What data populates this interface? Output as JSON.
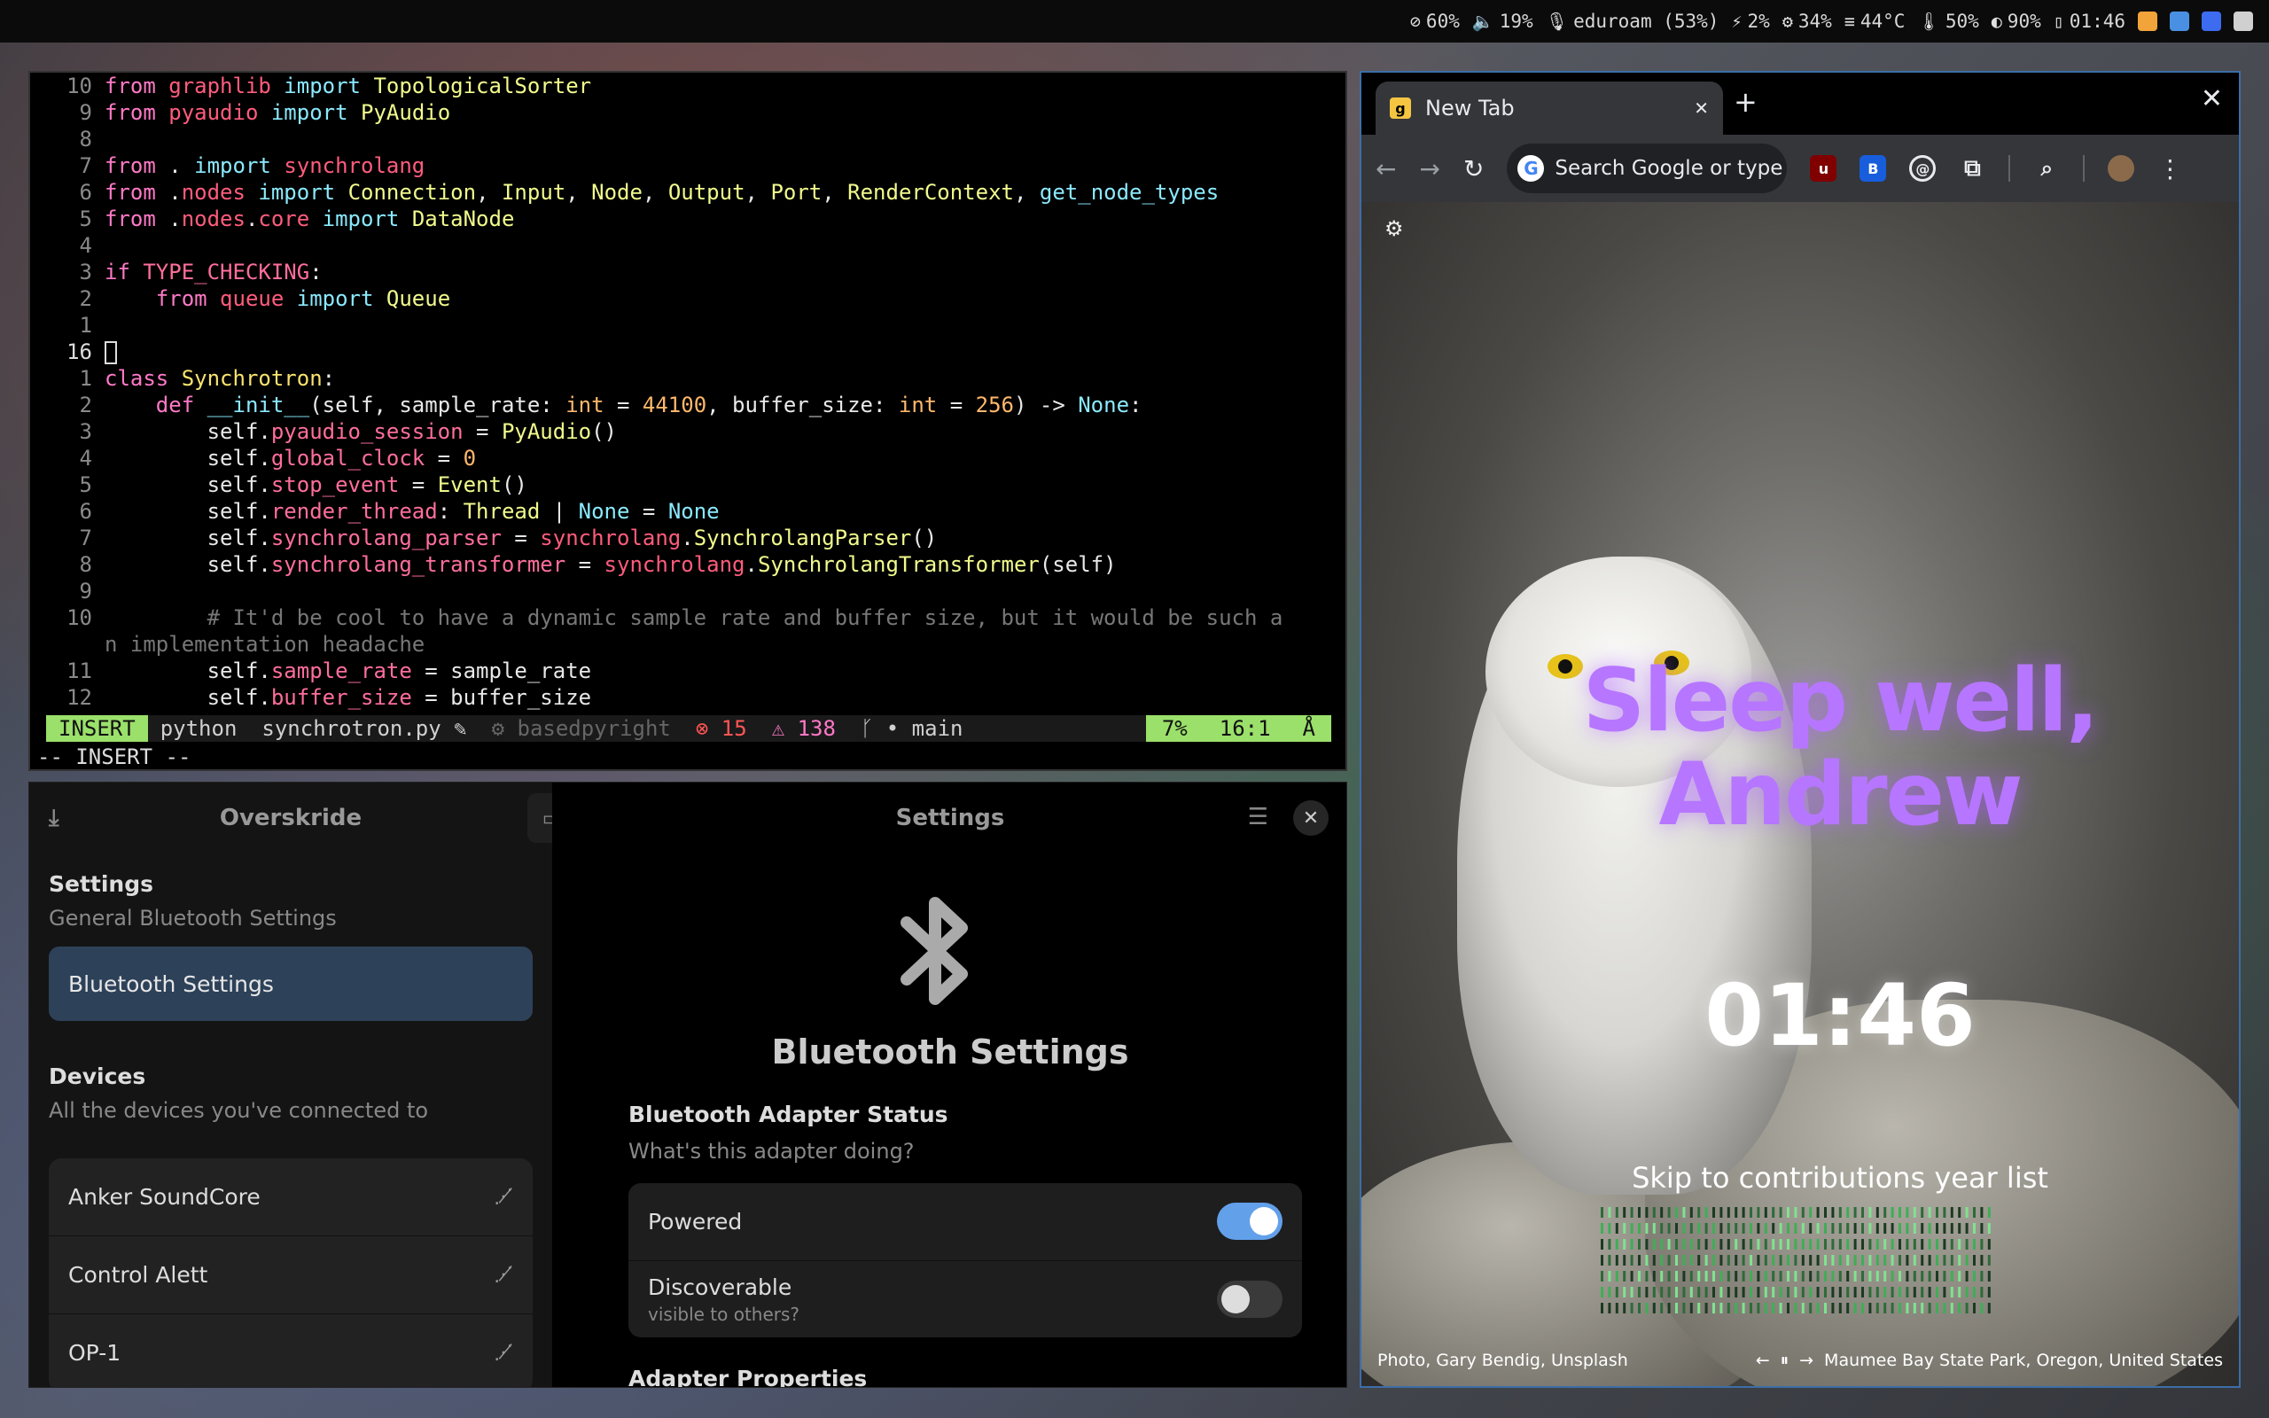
{
  "topbar": {
    "items": [
      {
        "icon": "eye-off-icon",
        "glyph": "⊘",
        "text": "60%"
      },
      {
        "icon": "volume-icon",
        "glyph": "🔈",
        "text": "19%"
      },
      {
        "icon": "mic-icon",
        "glyph": "🎙",
        "text": "eduroam (53%)"
      },
      {
        "icon": "wifi-icon",
        "glyph": "⚡",
        "text": "2%"
      },
      {
        "icon": "cpu-icon",
        "glyph": "⚙",
        "text": "34%"
      },
      {
        "icon": "memory-icon",
        "glyph": "≡",
        "text": "44°C"
      },
      {
        "icon": "thermometer-icon",
        "glyph": "🌡",
        "text": "50%"
      },
      {
        "icon": "brightness-icon",
        "glyph": "◐",
        "text": "90%"
      },
      {
        "icon": "battery-icon",
        "glyph": "▯",
        "text": "01:46"
      }
    ],
    "tray_colors": [
      "#f2a33a",
      "#4a90e2",
      "#3d6cf0",
      "#d0d0d0"
    ]
  },
  "editor": {
    "lines": [
      {
        "n": "10",
        "html": "<span class='kw'>from</span> <span class='kw2'>graphlib</span> <span class='blue'>import</span> <span class='mod'>TopologicalSorter</span>"
      },
      {
        "n": "9",
        "html": "<span class='kw'>from</span> <span class='kw2'>pyaudio</span> <span class='blue'>import</span> <span class='mod'>PyAudio</span>"
      },
      {
        "n": "8",
        "html": ""
      },
      {
        "n": "7",
        "html": "<span class='kw'>from</span> . <span class='blue'>import</span> <span class='kw2'>synchrolang</span>"
      },
      {
        "n": "6",
        "html": "<span class='kw'>from</span> .<span class='kw2'>nodes</span> <span class='blue'>import</span> <span class='mod'>Connection</span>, <span class='mod'>Input</span>, <span class='mod'>Node</span>, <span class='mod'>Output</span>, <span class='mod'>Port</span>, <span class='mod'>RenderContext</span>, <span class='blue'>get_node_types</span>"
      },
      {
        "n": "5",
        "html": "<span class='kw'>from</span> .<span class='kw2'>nodes</span>.<span class='kw2'>core</span> <span class='blue'>import</span> <span class='mod'>DataNode</span>"
      },
      {
        "n": "4",
        "html": ""
      },
      {
        "n": "3",
        "html": "<span class='kw'>if</span> <span class='attr'>TYPE_CHECKING</span>:"
      },
      {
        "n": "2",
        "html": "    <span class='kw'>from</span> <span class='kw2'>queue</span> <span class='blue'>import</span> <span class='mod'>Queue</span>"
      },
      {
        "n": "1",
        "html": ""
      },
      {
        "n": "16",
        "cur": true,
        "html": "<span class='cursor'></span>"
      },
      {
        "n": "1",
        "html": "<span class='kw'>class</span> <span class='cls'>Synchrotron</span>:"
      },
      {
        "n": "2",
        "html": "    <span class='kw'>def</span> <span class='blue'>__init__</span>(self, sample_rate: <span class='num'>int</span> = <span class='num'>44100</span>, buffer_size: <span class='num'>int</span> = <span class='num'>256</span>) -> <span class='blue'>None</span>:"
      },
      {
        "n": "3",
        "html": "        self.<span class='attr'>pyaudio_session</span> = <span class='mod'>PyAudio</span>()"
      },
      {
        "n": "4",
        "html": "        self.<span class='attr'>global_clock</span> = <span class='num'>0</span>"
      },
      {
        "n": "5",
        "html": "        self.<span class='attr'>stop_event</span> = <span class='mod'>Event</span>()"
      },
      {
        "n": "6",
        "html": "        self.<span class='attr'>render_thread</span>: <span class='mod'>Thread</span> | <span class='blue'>None</span> = <span class='blue'>None</span>"
      },
      {
        "n": "7",
        "html": "        self.<span class='attr'>synchrolang_parser</span> = <span class='kw2'>synchrolang</span>.<span class='mod'>SynchrolangParser</span>()"
      },
      {
        "n": "8",
        "html": "        self.<span class='attr'>synchrolang_transformer</span> = <span class='kw2'>synchrolang</span>.<span class='mod'>SynchrolangTransformer</span>(self)"
      },
      {
        "n": "9",
        "html": ""
      },
      {
        "n": "10",
        "html": "        <span class='cmt'># It'd be cool to have a dynamic sample rate and buffer size, but it would be such a</span>"
      },
      {
        "n": "",
        "html": "<span class='cmt'>n implementation headache</span>"
      },
      {
        "n": "11",
        "html": "        self.<span class='attr'>sample_rate</span> = sample_rate"
      },
      {
        "n": "12",
        "html": "        self.<span class='attr'>buffer_size</span> = buffer_size"
      }
    ],
    "status": {
      "mode": "INSERT",
      "filetype": "python",
      "filename": "synchrotron.py ✎",
      "lsp": "⚙ basedpyright",
      "errors": "⊗ 15",
      "warnings": "⚠ 138",
      "branch": "ᚴ • main",
      "percent": "7%",
      "position": "16:1",
      "end": "Å"
    },
    "modeline": "-- INSERT --"
  },
  "overskride": {
    "sidebar_title": "Overskride",
    "main_title": "Settings",
    "settings_heading": "Settings",
    "settings_sub": "General Bluetooth Settings",
    "selected_item": "Bluetooth Settings",
    "devices_heading": "Devices",
    "devices_sub": "All the devices you've connected to",
    "devices": [
      "Anker SoundCore",
      "Control Alett",
      "OP-1"
    ],
    "page_title": "Bluetooth Settings",
    "status_title": "Bluetooth Adapter Status",
    "status_sub": "What's this adapter doing?",
    "powered_label": "Powered",
    "powered": true,
    "discoverable_label": "Discoverable",
    "discoverable_hint": "visible to others?",
    "discoverable": false,
    "properties_title": "Adapter Properties"
  },
  "browser": {
    "tab_title": "New Tab",
    "omnibox_placeholder": "Search Google or type a URL",
    "greeting": "Sleep well, Andrew",
    "clock": "01:46",
    "skip_link": "Skip to contributions year list",
    "photo_credit": "Photo, Gary Bendig, Unsplash",
    "location": "Maumee Bay State Park, Oregon, United States",
    "accent_color": "#b776ff"
  }
}
